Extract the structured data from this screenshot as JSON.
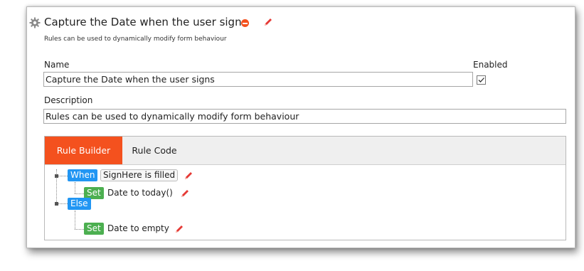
{
  "rule": {
    "title": "Capture the Date when the user signs",
    "subtitle": "Rules can be used to dynamically modify form behaviour"
  },
  "form": {
    "name_label": "Name",
    "name_value": "Capture the Date when the user signs",
    "enabled_label": "Enabled",
    "enabled_checked": true,
    "description_label": "Description",
    "description_value": "Rules can be used to dynamically modify form behaviour"
  },
  "tabs": [
    {
      "label": "Rule Builder",
      "active": true
    },
    {
      "label": "Rule Code",
      "active": false
    }
  ],
  "tree": {
    "when_label": "When",
    "condition": "SignHere is filled",
    "set_label_1": "Set",
    "action_1": "Date to today()",
    "else_label": "Else",
    "set_label_2": "Set",
    "action_2": "Date to empty"
  },
  "colors": {
    "accent": "#f4511e",
    "when_blue": "#2196f3",
    "set_green": "#4caf50",
    "edit_pencil": "#e53935"
  },
  "icons": [
    "gear-icon",
    "remove-icon",
    "pencil-icon",
    "checkmark-icon",
    "tree-node-icon"
  ]
}
